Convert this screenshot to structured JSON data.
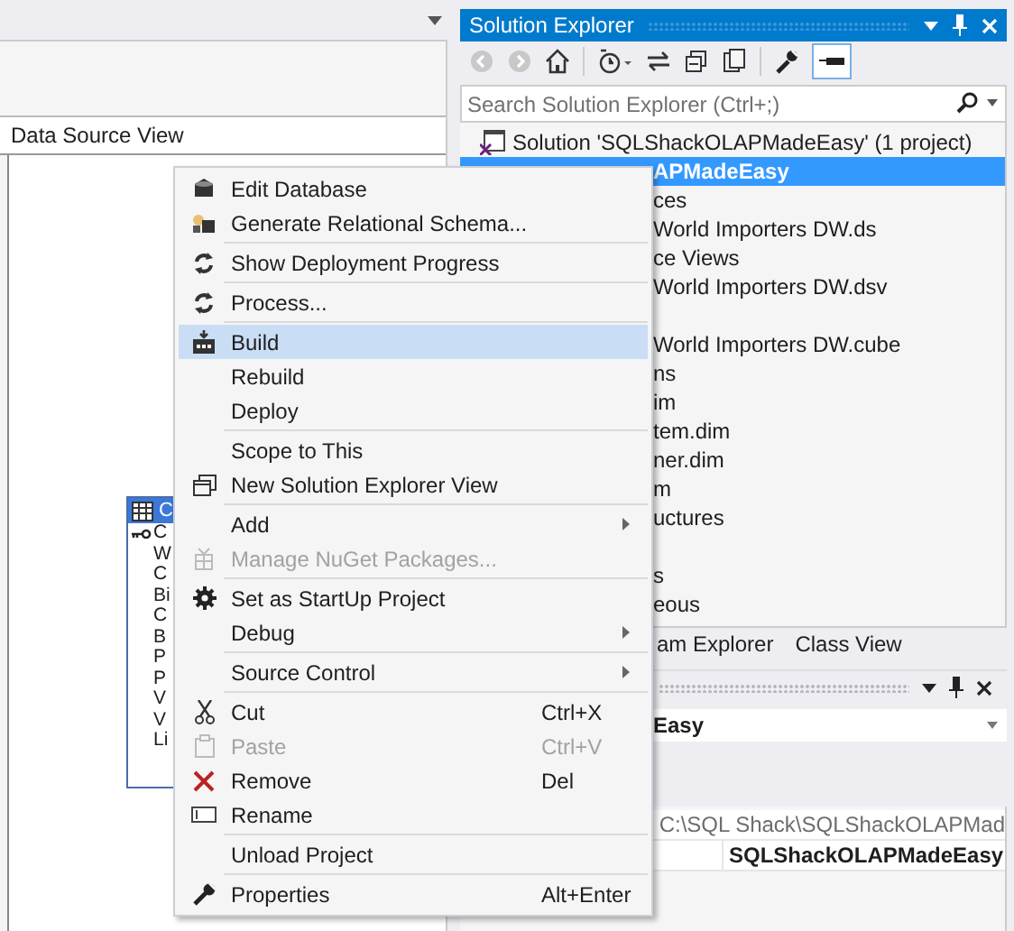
{
  "editor": {
    "panel_title": "Data Source View",
    "table": {
      "header": "C",
      "selected": true,
      "columns": [
        {
          "name": "C",
          "key": true
        },
        {
          "name": "W",
          "key": false
        },
        {
          "name": "C",
          "key": false
        },
        {
          "name": "Bi",
          "key": false
        },
        {
          "name": "C",
          "key": false
        },
        {
          "name": "B",
          "key": false
        },
        {
          "name": "P",
          "key": false
        },
        {
          "name": "P",
          "key": false
        },
        {
          "name": "V",
          "key": false
        },
        {
          "name": "V",
          "key": false
        },
        {
          "name": "Li",
          "key": false
        }
      ]
    }
  },
  "solution_explorer": {
    "title": "Solution Explorer",
    "search": {
      "placeholder": "Search Solution Explorer (Ctrl+;)"
    },
    "items": [
      {
        "text": "Solution 'SQLShackOLAPMadeEasy' (1 project)",
        "kind": "solution",
        "selected": false,
        "gap_before": false
      },
      {
        "text": "APMadeEasy",
        "kind": "covered",
        "selected": true,
        "gap_before": false
      },
      {
        "text": "ces",
        "kind": "covered",
        "selected": false,
        "gap_before": false
      },
      {
        "text": "World Importers DW.ds",
        "kind": "covered",
        "selected": false,
        "gap_before": false
      },
      {
        "text": "ce Views",
        "kind": "covered",
        "selected": false,
        "gap_before": false
      },
      {
        "text": "World Importers DW.dsv",
        "kind": "covered",
        "selected": false,
        "gap_before": false
      },
      {
        "text": "World Importers DW.cube",
        "kind": "covered",
        "selected": false,
        "gap_before": true
      },
      {
        "text": "ns",
        "kind": "covered",
        "selected": false,
        "gap_before": false
      },
      {
        "text": "im",
        "kind": "covered",
        "selected": false,
        "gap_before": false
      },
      {
        "text": "tem.dim",
        "kind": "covered",
        "selected": false,
        "gap_before": false
      },
      {
        "text": "ner.dim",
        "kind": "covered",
        "selected": false,
        "gap_before": false
      },
      {
        "text": "m",
        "kind": "covered",
        "selected": false,
        "gap_before": false
      },
      {
        "text": "uctures",
        "kind": "covered",
        "selected": false,
        "gap_before": false
      },
      {
        "text": "s",
        "kind": "covered",
        "selected": false,
        "gap_before": true
      },
      {
        "text": "eous",
        "kind": "covered",
        "selected": false,
        "gap_before": false
      }
    ],
    "tabs": [
      {
        "label": "am Explorer",
        "selected": false
      },
      {
        "label": "Class View",
        "selected": false
      }
    ]
  },
  "properties": {
    "object": "Easy",
    "rows": [
      {
        "value": "C:\\SQL Shack\\SQLShackOLAPMad",
        "kind": "readonly"
      },
      {
        "value": "SQLShackOLAPMadeEasy",
        "kind": "name"
      }
    ]
  },
  "context_menu": [
    {
      "label": "Edit Database",
      "kind": "database",
      "disabled": false,
      "selected": false,
      "submenu": false,
      "separator_after": false
    },
    {
      "label": "Generate Relational Schema...",
      "kind": "schema",
      "disabled": false,
      "selected": false,
      "submenu": false,
      "separator_after": true
    },
    {
      "label": "Show Deployment Progress",
      "kind": "refresh",
      "disabled": false,
      "selected": false,
      "submenu": false,
      "separator_after": true
    },
    {
      "label": "Process...",
      "kind": "refresh",
      "disabled": false,
      "selected": false,
      "submenu": false,
      "separator_after": true
    },
    {
      "label": "Build",
      "kind": "build",
      "disabled": false,
      "selected": true,
      "submenu": false,
      "separator_after": false
    },
    {
      "label": "Rebuild",
      "kind": "plain",
      "disabled": false,
      "selected": false,
      "submenu": false,
      "separator_after": false
    },
    {
      "label": "Deploy",
      "kind": "plain",
      "disabled": false,
      "selected": false,
      "submenu": false,
      "separator_after": true
    },
    {
      "label": "Scope to This",
      "kind": "plain",
      "disabled": false,
      "selected": false,
      "submenu": false,
      "separator_after": false
    },
    {
      "label": "New Solution Explorer View",
      "kind": "view",
      "disabled": false,
      "selected": false,
      "submenu": false,
      "separator_after": true
    },
    {
      "label": "Add",
      "kind": "plain",
      "disabled": false,
      "selected": false,
      "submenu": true,
      "separator_after": false
    },
    {
      "label": "Manage NuGet Packages...",
      "kind": "package",
      "disabled": true,
      "selected": false,
      "submenu": false,
      "separator_after": true
    },
    {
      "label": "Set as StartUp Project",
      "kind": "gear",
      "disabled": false,
      "selected": false,
      "submenu": false,
      "separator_after": false
    },
    {
      "label": "Debug",
      "kind": "plain",
      "disabled": false,
      "selected": false,
      "submenu": true,
      "separator_after": true
    },
    {
      "label": "Source Control",
      "kind": "plain",
      "disabled": false,
      "selected": false,
      "submenu": true,
      "separator_after": true
    },
    {
      "label": "Cut",
      "kind": "cut",
      "shortcut": "Ctrl+X",
      "disabled": false,
      "selected": false,
      "submenu": false,
      "separator_after": false
    },
    {
      "label": "Paste",
      "kind": "paste",
      "shortcut": "Ctrl+V",
      "disabled": true,
      "selected": false,
      "submenu": false,
      "separator_after": false
    },
    {
      "label": "Remove",
      "kind": "remove",
      "shortcut": "Del",
      "disabled": false,
      "selected": false,
      "submenu": false,
      "separator_after": false
    },
    {
      "label": "Rename",
      "kind": "rename",
      "disabled": false,
      "selected": false,
      "submenu": false,
      "separator_after": true
    },
    {
      "label": "Unload Project",
      "kind": "plain",
      "disabled": false,
      "selected": false,
      "submenu": false,
      "separator_after": true
    },
    {
      "label": "Properties",
      "kind": "wrench",
      "shortcut": "Alt+Enter",
      "disabled": false,
      "selected": false,
      "submenu": false,
      "separator_after": false
    }
  ]
}
